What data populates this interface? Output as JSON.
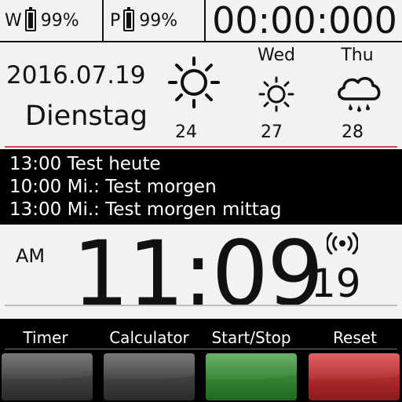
{
  "status": {
    "watch_label": "W",
    "watch_battery": "99%",
    "watch_battery_level": 0.99,
    "phone_label": "P",
    "phone_battery": "99%",
    "phone_battery_level": 0.99,
    "stopwatch": "00:00:000"
  },
  "date": {
    "date": "2016.07.19",
    "weekday": "Dienstag"
  },
  "weather": {
    "today": {
      "day": "",
      "icon": "sun-icon",
      "temp": "24"
    },
    "day2": {
      "day": "Wed",
      "icon": "sun-icon",
      "temp": "27"
    },
    "day3": {
      "day": "Thu",
      "icon": "rain-cloud-icon",
      "temp": "28"
    }
  },
  "agenda": [
    "13:00 Test heute",
    "10:00 Mi.: Test morgen",
    "13:00 Mi.: Test morgen mittag"
  ],
  "clock": {
    "ampm": "AM",
    "time": "11:09",
    "seconds": "19",
    "alarm_icon": "wireless-signal-icon"
  },
  "buttons": {
    "timer": "Timer",
    "calculator": "Calculator",
    "startstop": "Start/Stop",
    "reset": "Reset"
  },
  "colors": {
    "accent_line": "#d04848",
    "start_button": "#2e8a2e",
    "reset_button": "#b52a2a",
    "neutral_button": "#3a3a3a"
  }
}
